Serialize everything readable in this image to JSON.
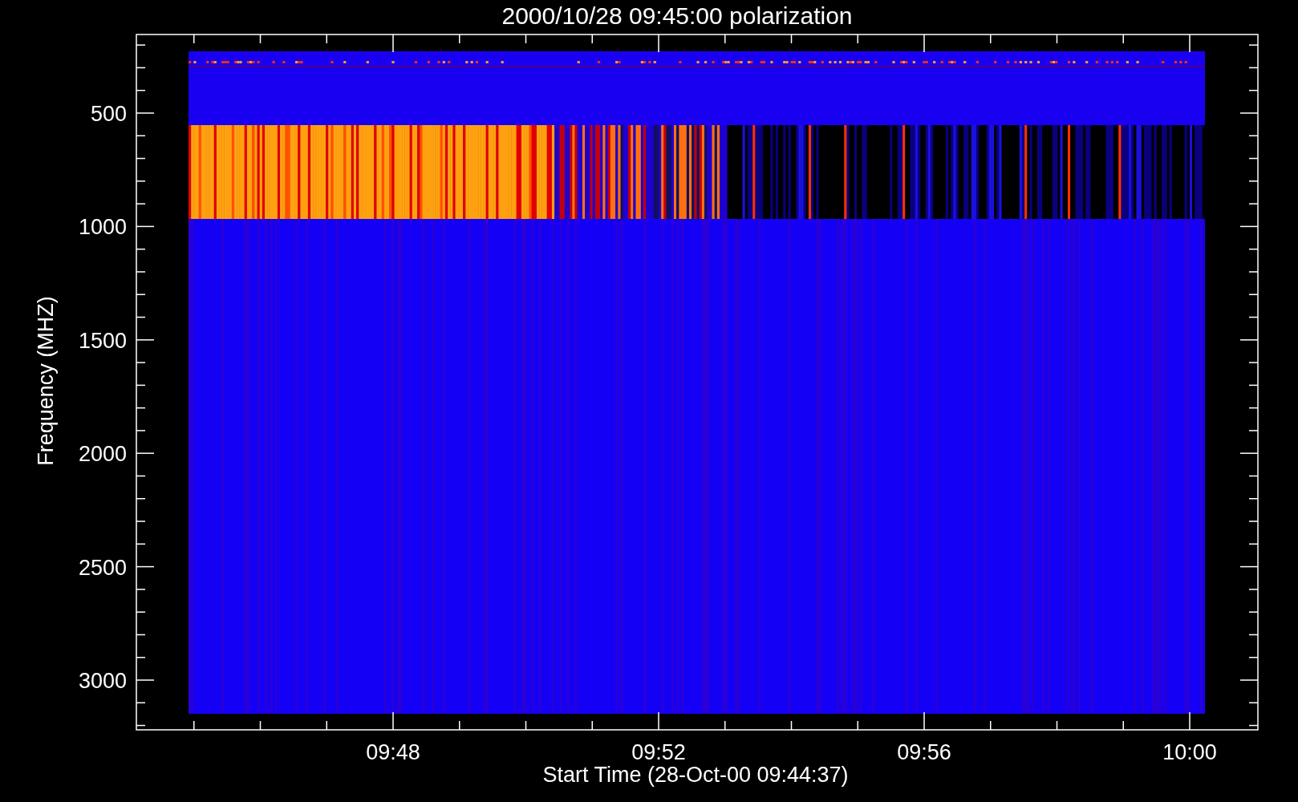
{
  "plot": {
    "title": "2000/10/28 09:45:00 polarization",
    "ylabel": "Frequency (MHZ)",
    "xlabel": "Start Time (28-Oct-00 09:44:37)",
    "yticks": [
      "500",
      "1000",
      "1500",
      "2000",
      "2500",
      "3000"
    ],
    "xticks": [
      "09:48",
      "09:52",
      "09:56",
      "10:00"
    ]
  }
}
